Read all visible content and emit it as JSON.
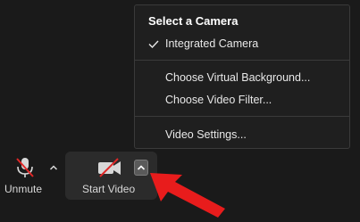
{
  "menu": {
    "header": "Select a Camera",
    "items": [
      {
        "label": "Integrated Camera",
        "checked": true
      },
      {
        "label": "Choose Virtual Background..."
      },
      {
        "label": "Choose Video Filter..."
      },
      {
        "label": "Video Settings..."
      }
    ]
  },
  "toolbar": {
    "unmute_label": "Unmute",
    "start_video_label": "Start Video"
  },
  "colors": {
    "menu_bg": "#1f1f1f",
    "toolbar_bg": "#1a1a1a",
    "slash_red": "#e02828",
    "arrow_red": "#e81c1c"
  },
  "icons": {
    "check": "checkmark-icon",
    "microphone": "microphone-muted-icon",
    "camera": "video-camera-off-icon",
    "caret": "chevron-up-icon",
    "annotation": "red-arrow-icon"
  }
}
